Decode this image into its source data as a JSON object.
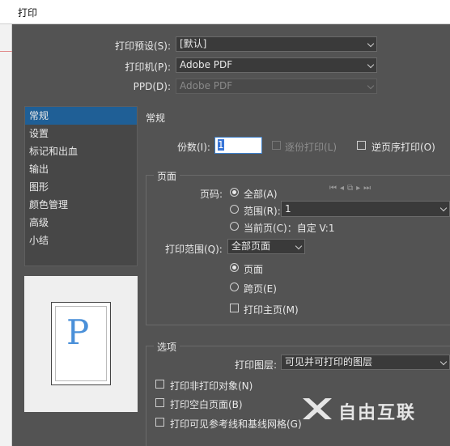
{
  "window": {
    "title": "打印"
  },
  "top": {
    "preset_label": "打印预设(S):",
    "preset_value": "[默认]",
    "printer_label": "打印机(P):",
    "printer_value": "Adobe PDF",
    "ppd_label": "PPD(D):",
    "ppd_value": "Adobe PDF"
  },
  "sidebar": {
    "items": [
      {
        "label": "常规"
      },
      {
        "label": "设置"
      },
      {
        "label": "标记和出血"
      },
      {
        "label": "输出"
      },
      {
        "label": "图形"
      },
      {
        "label": "颜色管理"
      },
      {
        "label": "高级"
      },
      {
        "label": "小结"
      }
    ]
  },
  "preview": {
    "glyph": "P"
  },
  "general": {
    "section_title": "常规",
    "copies_label": "份数(I):",
    "copies_value": "1",
    "collate_label": "逐份打印(L)",
    "reverse_label": "逆页序打印(O)"
  },
  "pages": {
    "group_title": "页面",
    "pages_label": "页码:",
    "all_label": "全部(A)",
    "range_label": "范围(R):",
    "range_value": "1",
    "current_label": "当前页(C)：自定 V:1",
    "print_range_label": "打印范围(Q):",
    "print_range_value": "全部页面",
    "pages_option": "页面",
    "spreads_option": "跨页(E)",
    "master_label": "打印主页(M)"
  },
  "options": {
    "group_title": "选项",
    "layers_label": "打印图层:",
    "layers_value": "可见并可打印的图层",
    "nonprint_label": "打印非打印对象(N)",
    "blank_label": "打印空白页面(B)",
    "guides_label": "打印可见参考线和基线网格(G)"
  },
  "watermark": {
    "text": "自由互联"
  }
}
